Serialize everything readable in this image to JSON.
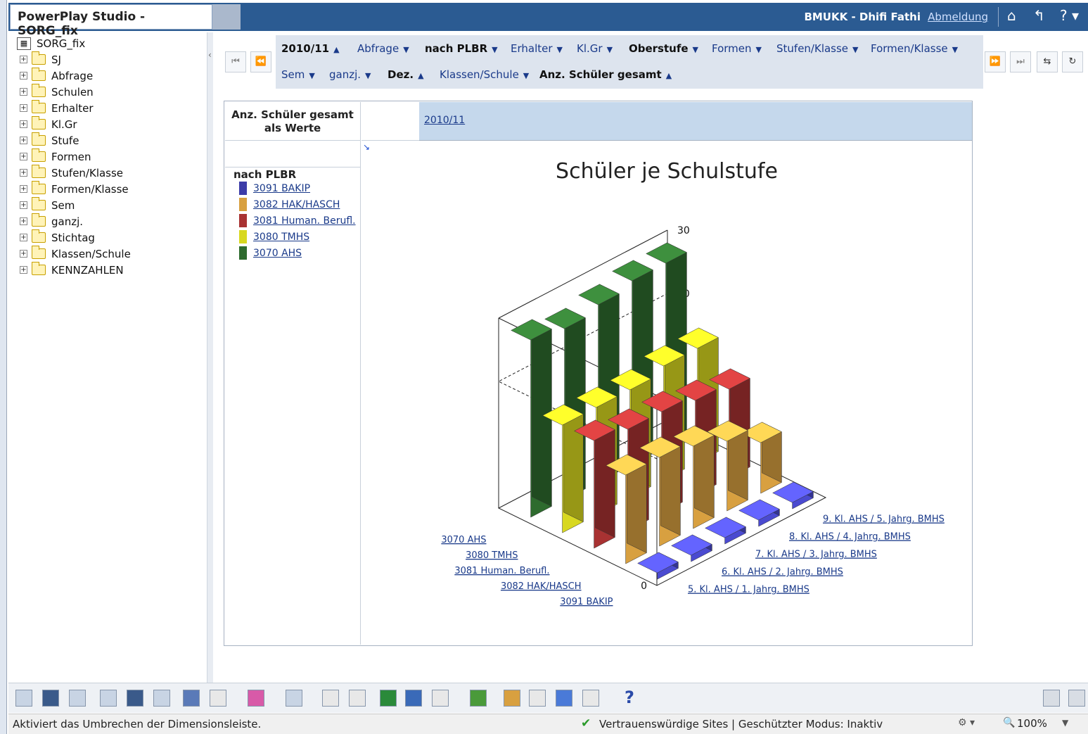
{
  "app": {
    "title": "PowerPlay Studio - SORG_fix",
    "user": "BMUKK - Dhifi Fathi",
    "logout": "Abmeldung"
  },
  "tree": {
    "root": "SORG_fix",
    "items": [
      "SJ",
      "Abfrage",
      "Schulen",
      "Erhalter",
      "Kl.Gr",
      "Stufe",
      "Formen",
      "Stufen/Klasse",
      "Formen/Klasse",
      "Sem",
      "ganzj.",
      "Stichtag",
      "Klassen/Schule",
      "KENNZAHLEN"
    ]
  },
  "dimensions": {
    "row1": [
      {
        "label": "2010/11",
        "bold": true,
        "arrow": "▲"
      },
      {
        "label": "Abfrage",
        "bold": false,
        "arrow": "▼"
      },
      {
        "label": "nach PLBR",
        "bold": true,
        "arrow": "▼"
      },
      {
        "label": "Erhalter",
        "bold": false,
        "arrow": "▼"
      },
      {
        "label": "Kl.Gr",
        "bold": false,
        "arrow": "▼"
      },
      {
        "label": "Oberstufe",
        "bold": true,
        "arrow": "▼"
      },
      {
        "label": "Formen",
        "bold": false,
        "arrow": "▼"
      },
      {
        "label": "Stufen/Klasse",
        "bold": false,
        "arrow": "▼"
      },
      {
        "label": "Formen/Klasse",
        "bold": false,
        "arrow": "▼"
      }
    ],
    "row2": [
      {
        "label": "Sem",
        "bold": false,
        "arrow": "▼"
      },
      {
        "label": "ganzj.",
        "bold": false,
        "arrow": "▼"
      },
      {
        "label": "Dez.",
        "bold": true,
        "arrow": "▲"
      },
      {
        "label": "Klassen/Schule",
        "bold": false,
        "arrow": "▼"
      },
      {
        "label": "Anz. Schüler gesamt",
        "bold": true,
        "arrow": "▲"
      }
    ]
  },
  "crosstab": {
    "measure_label_line1": "Anz. Schüler gesamt",
    "measure_label_line2": "als Werte",
    "column_header": "2010/11",
    "legend_title": "nach PLBR"
  },
  "legend": [
    {
      "label": "3091 BAKIP",
      "color": "#3c3ca8"
    },
    {
      "label": "3082 HAK/HASCH",
      "color": "#d8a040"
    },
    {
      "label": "3081 Human. Berufl.",
      "color": "#a83232"
    },
    {
      "label": "3080 TMHS",
      "color": "#d8d820"
    },
    {
      "label": "3070 AHS",
      "color": "#2e6b2e"
    }
  ],
  "chart_data": {
    "type": "bar",
    "title": "Schüler je Schulstufe",
    "categories": [
      "5. Kl. AHS / 1. Jahrg. BMHS",
      "6. Kl. AHS / 2. Jahrg. BMHS",
      "7. Kl. AHS / 3. Jahrg. BMHS",
      "8. Kl. AHS / 4. Jahrg. BMHS",
      "9. Kl. AHS / 5. Jahrg. BMHS"
    ],
    "series": [
      {
        "name": "3070 AHS",
        "values": [
          28,
          27,
          28,
          29,
          29
        ],
        "color": "#2e6b2e"
      },
      {
        "name": "3080 TMHS",
        "values": [
          17,
          17,
          17,
          18,
          18
        ],
        "color": "#d8d820"
      },
      {
        "name": "3081 Human. Berufl.",
        "values": [
          17,
          16,
          16,
          15,
          14
        ],
        "color": "#a83232"
      },
      {
        "name": "3082 HAK/HASCH",
        "values": [
          14,
          14,
          13,
          11,
          8
        ],
        "color": "#d8a040"
      },
      {
        "name": "3091 BAKIP",
        "values": [
          1,
          1,
          1,
          1,
          1
        ],
        "color": "#4a4ad0"
      }
    ],
    "ylim": [
      0,
      30
    ],
    "yticks": [
      "0",
      "20",
      "30"
    ],
    "grid": true,
    "legend": "left"
  },
  "statusbar": {
    "text": "Aktiviert das Umbrechen der Dimensionsleiste.",
    "trust": "Vertrauenswürdige Sites | Geschützter Modus: Inaktiv",
    "zoom": "100%"
  }
}
